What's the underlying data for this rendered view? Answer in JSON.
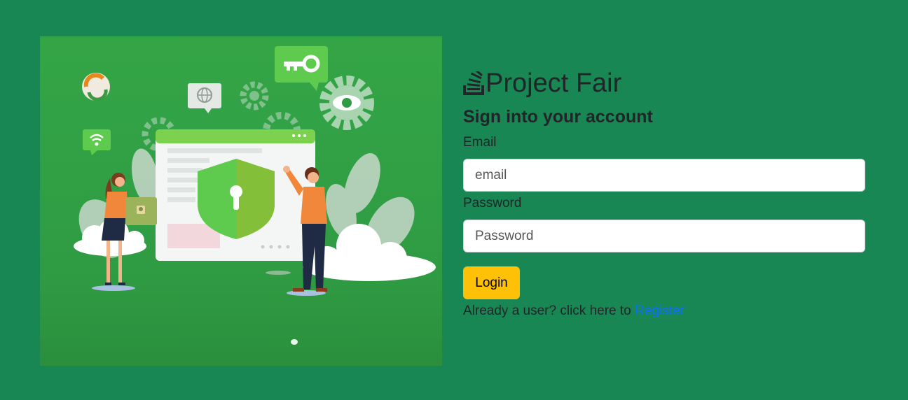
{
  "brand": {
    "name": "Project Fair",
    "icon": "stack-icon"
  },
  "form": {
    "heading": "Sign into your account",
    "email_label": "Email",
    "email_placeholder": "email",
    "password_label": "Password",
    "password_placeholder": "Password",
    "login_label": "Login",
    "register_prompt": "Already a user? click here to",
    "register_link": "Register"
  },
  "colors": {
    "background": "#198754",
    "login_button": "#ffc107",
    "link": "#0d6efd"
  }
}
